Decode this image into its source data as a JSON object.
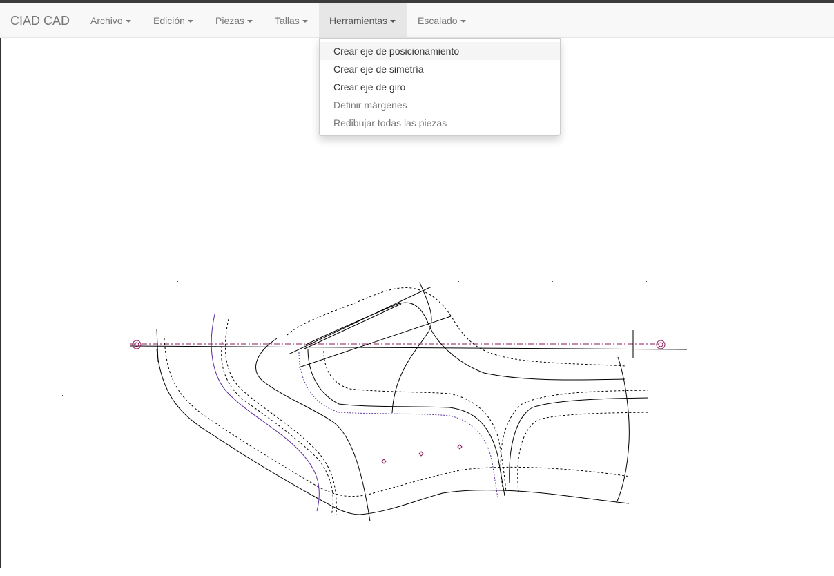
{
  "navbar": {
    "brand": "CIAD CAD",
    "menus": [
      {
        "label": "Archivo"
      },
      {
        "label": "Edición"
      },
      {
        "label": "Piezas"
      },
      {
        "label": "Tallas"
      },
      {
        "label": "Herramientas"
      },
      {
        "label": "Escalado"
      }
    ]
  },
  "dropdown": {
    "items": [
      {
        "label": "Crear eje de posicionamiento",
        "state": "hover"
      },
      {
        "label": "Crear eje de simetría",
        "state": "enabled"
      },
      {
        "label": "Crear eje de giro",
        "state": "enabled"
      },
      {
        "label": "Definir márgenes",
        "state": "disabled"
      },
      {
        "label": "Redibujar todas las piezas",
        "state": "disabled"
      }
    ]
  },
  "colors": {
    "top_strip": "#3c3c3c",
    "navbar_bg": "#f8f8f8",
    "open_menu_bg": "#e7e7e7",
    "axis_color": "#8b1a5a",
    "curve_purple": "#5a2d9a",
    "line_black": "#000000"
  }
}
